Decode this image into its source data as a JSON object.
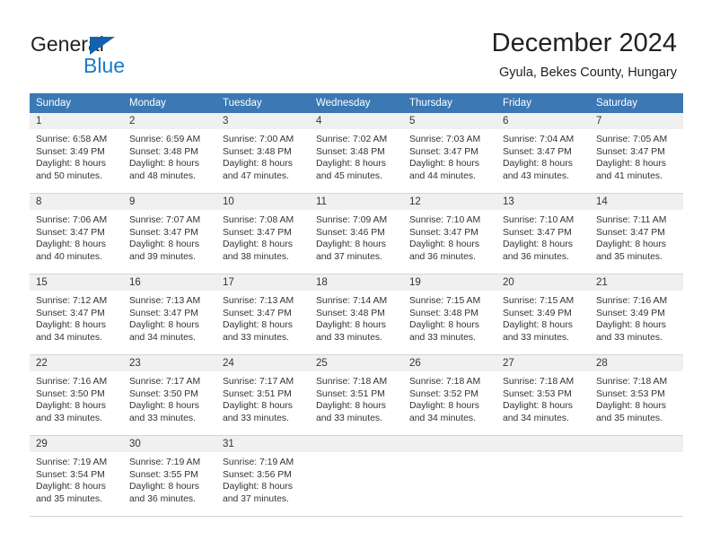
{
  "brand": {
    "name_part1": "General",
    "name_part2": "Blue",
    "triangle_icon": "triangle-icon",
    "accent_color": "#1a7bc9",
    "triangle_color": "#1263af"
  },
  "header": {
    "title": "December 2024",
    "subtitle": "Gyula, Bekes County, Hungary"
  },
  "calendar": {
    "header_bg": "#3b78b4",
    "daynum_bg": "#f0f0f0",
    "weekday_headers": [
      "Sunday",
      "Monday",
      "Tuesday",
      "Wednesday",
      "Thursday",
      "Friday",
      "Saturday"
    ],
    "weeks": [
      [
        {
          "day": "1",
          "sunrise": "Sunrise: 6:58 AM",
          "sunset": "Sunset: 3:49 PM",
          "daylight_line1": "Daylight: 8 hours",
          "daylight_line2": "and 50 minutes."
        },
        {
          "day": "2",
          "sunrise": "Sunrise: 6:59 AM",
          "sunset": "Sunset: 3:48 PM",
          "daylight_line1": "Daylight: 8 hours",
          "daylight_line2": "and 48 minutes."
        },
        {
          "day": "3",
          "sunrise": "Sunrise: 7:00 AM",
          "sunset": "Sunset: 3:48 PM",
          "daylight_line1": "Daylight: 8 hours",
          "daylight_line2": "and 47 minutes."
        },
        {
          "day": "4",
          "sunrise": "Sunrise: 7:02 AM",
          "sunset": "Sunset: 3:48 PM",
          "daylight_line1": "Daylight: 8 hours",
          "daylight_line2": "and 45 minutes."
        },
        {
          "day": "5",
          "sunrise": "Sunrise: 7:03 AM",
          "sunset": "Sunset: 3:47 PM",
          "daylight_line1": "Daylight: 8 hours",
          "daylight_line2": "and 44 minutes."
        },
        {
          "day": "6",
          "sunrise": "Sunrise: 7:04 AM",
          "sunset": "Sunset: 3:47 PM",
          "daylight_line1": "Daylight: 8 hours",
          "daylight_line2": "and 43 minutes."
        },
        {
          "day": "7",
          "sunrise": "Sunrise: 7:05 AM",
          "sunset": "Sunset: 3:47 PM",
          "daylight_line1": "Daylight: 8 hours",
          "daylight_line2": "and 41 minutes."
        }
      ],
      [
        {
          "day": "8",
          "sunrise": "Sunrise: 7:06 AM",
          "sunset": "Sunset: 3:47 PM",
          "daylight_line1": "Daylight: 8 hours",
          "daylight_line2": "and 40 minutes."
        },
        {
          "day": "9",
          "sunrise": "Sunrise: 7:07 AM",
          "sunset": "Sunset: 3:47 PM",
          "daylight_line1": "Daylight: 8 hours",
          "daylight_line2": "and 39 minutes."
        },
        {
          "day": "10",
          "sunrise": "Sunrise: 7:08 AM",
          "sunset": "Sunset: 3:47 PM",
          "daylight_line1": "Daylight: 8 hours",
          "daylight_line2": "and 38 minutes."
        },
        {
          "day": "11",
          "sunrise": "Sunrise: 7:09 AM",
          "sunset": "Sunset: 3:46 PM",
          "daylight_line1": "Daylight: 8 hours",
          "daylight_line2": "and 37 minutes."
        },
        {
          "day": "12",
          "sunrise": "Sunrise: 7:10 AM",
          "sunset": "Sunset: 3:47 PM",
          "daylight_line1": "Daylight: 8 hours",
          "daylight_line2": "and 36 minutes."
        },
        {
          "day": "13",
          "sunrise": "Sunrise: 7:10 AM",
          "sunset": "Sunset: 3:47 PM",
          "daylight_line1": "Daylight: 8 hours",
          "daylight_line2": "and 36 minutes."
        },
        {
          "day": "14",
          "sunrise": "Sunrise: 7:11 AM",
          "sunset": "Sunset: 3:47 PM",
          "daylight_line1": "Daylight: 8 hours",
          "daylight_line2": "and 35 minutes."
        }
      ],
      [
        {
          "day": "15",
          "sunrise": "Sunrise: 7:12 AM",
          "sunset": "Sunset: 3:47 PM",
          "daylight_line1": "Daylight: 8 hours",
          "daylight_line2": "and 34 minutes."
        },
        {
          "day": "16",
          "sunrise": "Sunrise: 7:13 AM",
          "sunset": "Sunset: 3:47 PM",
          "daylight_line1": "Daylight: 8 hours",
          "daylight_line2": "and 34 minutes."
        },
        {
          "day": "17",
          "sunrise": "Sunrise: 7:13 AM",
          "sunset": "Sunset: 3:47 PM",
          "daylight_line1": "Daylight: 8 hours",
          "daylight_line2": "and 33 minutes."
        },
        {
          "day": "18",
          "sunrise": "Sunrise: 7:14 AM",
          "sunset": "Sunset: 3:48 PM",
          "daylight_line1": "Daylight: 8 hours",
          "daylight_line2": "and 33 minutes."
        },
        {
          "day": "19",
          "sunrise": "Sunrise: 7:15 AM",
          "sunset": "Sunset: 3:48 PM",
          "daylight_line1": "Daylight: 8 hours",
          "daylight_line2": "and 33 minutes."
        },
        {
          "day": "20",
          "sunrise": "Sunrise: 7:15 AM",
          "sunset": "Sunset: 3:49 PM",
          "daylight_line1": "Daylight: 8 hours",
          "daylight_line2": "and 33 minutes."
        },
        {
          "day": "21",
          "sunrise": "Sunrise: 7:16 AM",
          "sunset": "Sunset: 3:49 PM",
          "daylight_line1": "Daylight: 8 hours",
          "daylight_line2": "and 33 minutes."
        }
      ],
      [
        {
          "day": "22",
          "sunrise": "Sunrise: 7:16 AM",
          "sunset": "Sunset: 3:50 PM",
          "daylight_line1": "Daylight: 8 hours",
          "daylight_line2": "and 33 minutes."
        },
        {
          "day": "23",
          "sunrise": "Sunrise: 7:17 AM",
          "sunset": "Sunset: 3:50 PM",
          "daylight_line1": "Daylight: 8 hours",
          "daylight_line2": "and 33 minutes."
        },
        {
          "day": "24",
          "sunrise": "Sunrise: 7:17 AM",
          "sunset": "Sunset: 3:51 PM",
          "daylight_line1": "Daylight: 8 hours",
          "daylight_line2": "and 33 minutes."
        },
        {
          "day": "25",
          "sunrise": "Sunrise: 7:18 AM",
          "sunset": "Sunset: 3:51 PM",
          "daylight_line1": "Daylight: 8 hours",
          "daylight_line2": "and 33 minutes."
        },
        {
          "day": "26",
          "sunrise": "Sunrise: 7:18 AM",
          "sunset": "Sunset: 3:52 PM",
          "daylight_line1": "Daylight: 8 hours",
          "daylight_line2": "and 34 minutes."
        },
        {
          "day": "27",
          "sunrise": "Sunrise: 7:18 AM",
          "sunset": "Sunset: 3:53 PM",
          "daylight_line1": "Daylight: 8 hours",
          "daylight_line2": "and 34 minutes."
        },
        {
          "day": "28",
          "sunrise": "Sunrise: 7:18 AM",
          "sunset": "Sunset: 3:53 PM",
          "daylight_line1": "Daylight: 8 hours",
          "daylight_line2": "and 35 minutes."
        }
      ],
      [
        {
          "day": "29",
          "sunrise": "Sunrise: 7:19 AM",
          "sunset": "Sunset: 3:54 PM",
          "daylight_line1": "Daylight: 8 hours",
          "daylight_line2": "and 35 minutes."
        },
        {
          "day": "30",
          "sunrise": "Sunrise: 7:19 AM",
          "sunset": "Sunset: 3:55 PM",
          "daylight_line1": "Daylight: 8 hours",
          "daylight_line2": "and 36 minutes."
        },
        {
          "day": "31",
          "sunrise": "Sunrise: 7:19 AM",
          "sunset": "Sunset: 3:56 PM",
          "daylight_line1": "Daylight: 8 hours",
          "daylight_line2": "and 37 minutes."
        },
        {
          "day": "",
          "sunrise": "",
          "sunset": "",
          "daylight_line1": "",
          "daylight_line2": ""
        },
        {
          "day": "",
          "sunrise": "",
          "sunset": "",
          "daylight_line1": "",
          "daylight_line2": ""
        },
        {
          "day": "",
          "sunrise": "",
          "sunset": "",
          "daylight_line1": "",
          "daylight_line2": ""
        },
        {
          "day": "",
          "sunrise": "",
          "sunset": "",
          "daylight_line1": "",
          "daylight_line2": ""
        }
      ]
    ]
  }
}
